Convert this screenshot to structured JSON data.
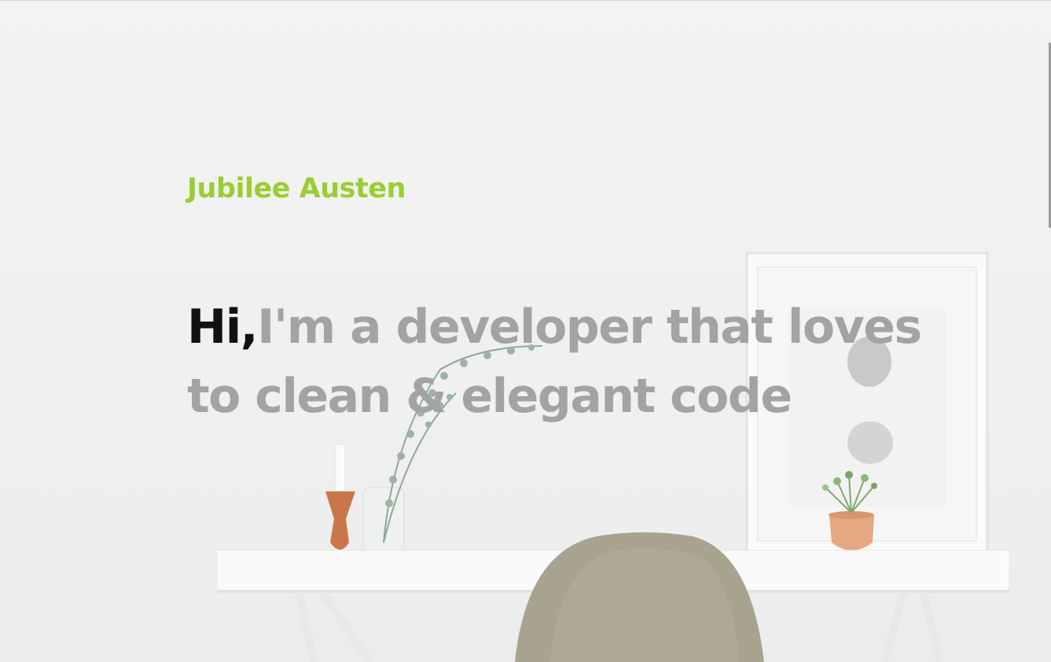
{
  "site": {
    "brand_name": "Jubilee Austen"
  },
  "hero": {
    "greeting": "Hi,",
    "tagline": "I'm a developer that loves to clean & elegant code"
  },
  "colors": {
    "brand": "#9acd32",
    "greeting": "#111111",
    "tagline": "#a3a3a3",
    "background": "#f1f1f1"
  }
}
